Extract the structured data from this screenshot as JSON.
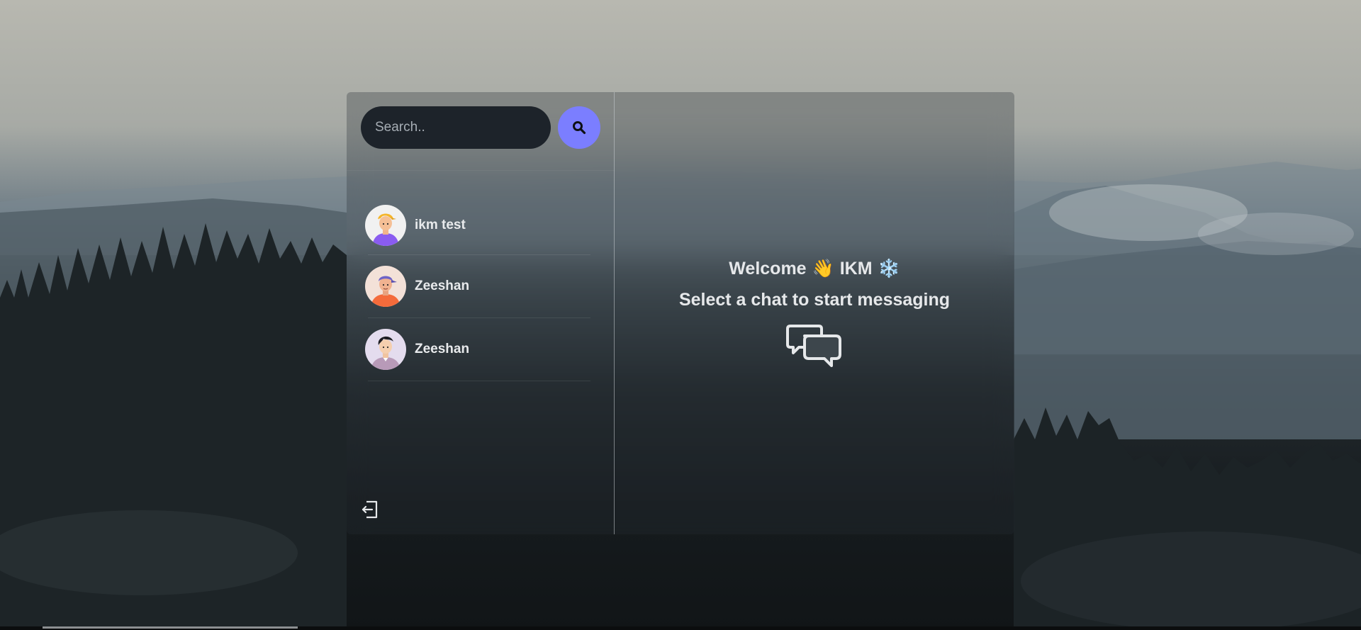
{
  "search": {
    "placeholder": "Search..",
    "button_icon": "search-icon"
  },
  "contacts": [
    {
      "name": "ikm test",
      "avatar": "avatar-yellow-cap"
    },
    {
      "name": "Zeeshan",
      "avatar": "avatar-purple-cap"
    },
    {
      "name": "Zeeshan",
      "avatar": "avatar-dark-hair"
    }
  ],
  "sidebar_footer": {
    "logout_icon": "logout-icon"
  },
  "welcome": {
    "greeting": "Welcome",
    "wave_emoji": "👋",
    "username": "IKM",
    "snow_emoji": "❄️",
    "subtitle": "Select a chat to start messaging",
    "icon": "chat-bubbles-icon"
  },
  "colors": {
    "accent": "#7b7eff",
    "input_bg": "#1d232a",
    "text": "#e6e8ea"
  }
}
